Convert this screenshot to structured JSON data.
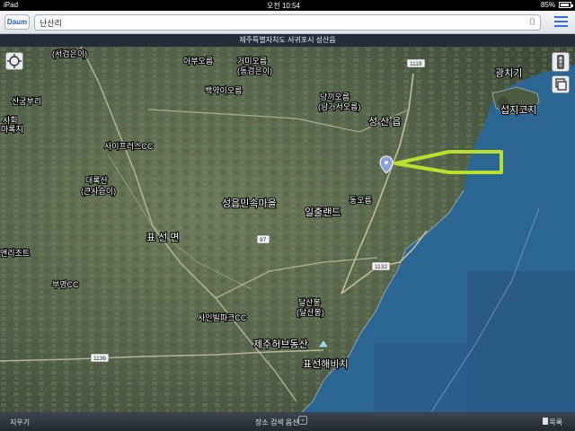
{
  "status": {
    "device": "iPad",
    "time": "오전 10:54",
    "battery": "85%",
    "battery_level": 0.85
  },
  "toolbar": {
    "logo": "Daum",
    "search_value": "난산리"
  },
  "location_bar": {
    "text": "제주특별자치도 서귀포시 성산읍"
  },
  "map": {
    "type": "satellite",
    "labels": {
      "seogeoreum": "(서검은이)",
      "abuoreum": "아부오름",
      "geomeunioreum": "거미오름",
      "dongeomeuni": "(동검은이)",
      "gwangchigi": "광치기",
      "sangundburi": "산굼부리",
      "baegyakioreum": "백약이오름",
      "nangkkioreum": "낭끼오름",
      "namgeoseoreum": "(남거서오름)",
      "seopjikoji": "섭지코지",
      "sahoe": "사회",
      "maroksi": "마록지",
      "seongsaneup": "성 산 읍",
      "saipeuleoseu": "사이프러스CC",
      "daeroksan": "대록산",
      "keunsaseumi": "(큰사슴이)",
      "dongoreum": "동오름",
      "seongeup": "성읍민속마을",
      "ilchullaend": "일출랜드",
      "pyoseonmyeon": "표 선 면",
      "aenglijoteu": "앤리조트",
      "buyeongcc": "부영CC",
      "sainbeupakcc": "사인빌파크CC",
      "dalsanbong": "달산봉",
      "dalsanbong2": "(달산봉)",
      "jejuhebeu": "제주허브동산",
      "pyoseonhaebi": "표선해비치"
    },
    "roads": [
      "1119",
      "97",
      "1132",
      "1136"
    ]
  },
  "bottom": {
    "left": "지우기",
    "center": "장소 검색 옵션",
    "right": "목록"
  }
}
